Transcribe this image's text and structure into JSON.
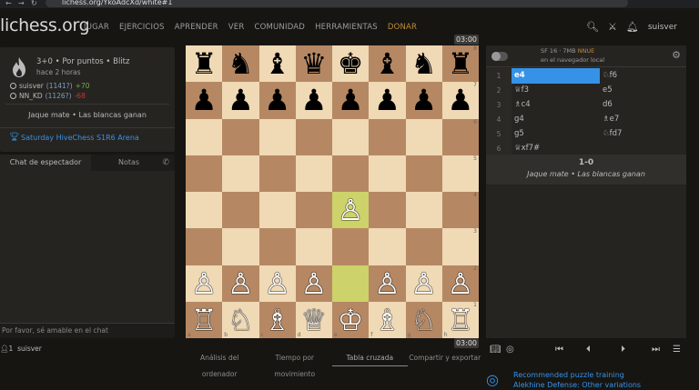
{
  "browser": {
    "url": "lichess.org/YkoAdcXd/white#1"
  },
  "header": {
    "logo": "lichess.org",
    "nav": [
      "JUGAR",
      "EJERCICIOS",
      "APRENDER",
      "VER",
      "COMUNIDAD",
      "HERRAMIENTAS",
      "DONAR"
    ],
    "username": "suisver"
  },
  "game": {
    "title": "3+0 • Por puntos • Blitz",
    "time_ago": "hace 2 horas",
    "white": {
      "name": "suisver",
      "rating": "(1141?)",
      "diff": "+70"
    },
    "black": {
      "name": "NN_KD",
      "rating": "(1126?)",
      "diff": "-68"
    },
    "result": "Jaque mate • Las blancas ganan",
    "tournament": "Saturday HiveChess S1R6 Arena"
  },
  "chat": {
    "tab_active": "Chat de espectador",
    "tab_notes": "Notas",
    "placeholder": "Por favor, sé amable en el chat",
    "spectators_count": "1",
    "spectator": "suisver"
  },
  "clocks": {
    "top": "03:00",
    "bottom": "03:00"
  },
  "board": {
    "ranks": [
      [
        "♜",
        "♞",
        "♝",
        "♛",
        "♚",
        "♝",
        "♞",
        "♜"
      ],
      [
        "♟",
        "♟",
        "♟",
        "♟",
        "♟",
        "♟",
        "♟",
        "♟"
      ],
      [
        "",
        "",
        "",
        "",
        "",
        "",
        "",
        ""
      ],
      [
        "",
        "",
        "",
        "",
        "",
        "",
        "",
        ""
      ],
      [
        "",
        "",
        "",
        "",
        "♙",
        "",
        "",
        ""
      ],
      [
        "",
        "",
        "",
        "",
        "",
        "",
        "",
        ""
      ],
      [
        "♙",
        "♙",
        "♙",
        "♙",
        "",
        "♙",
        "♙",
        "♙"
      ],
      [
        "♖",
        "♘",
        "♗",
        "♕",
        "♔",
        "♗",
        "♘",
        "♖"
      ]
    ],
    "rank_labels": [
      "8",
      "7",
      "6",
      "5",
      "4",
      "3",
      "2",
      "1"
    ],
    "file_labels": [
      "a",
      "b",
      "c",
      "d",
      "e",
      "f",
      "g",
      "h"
    ]
  },
  "board_tabs": [
    "Análisis del ordenador",
    "Tiempo por movimiento",
    "Tabla cruzada",
    "Compartir y exportar"
  ],
  "engine": {
    "name": "SF 16 · 7MB",
    "nnue": "NNUE",
    "location": "en el navegador local"
  },
  "moves": [
    {
      "n": "1",
      "w": "e4",
      "b": "♘f6"
    },
    {
      "n": "2",
      "w": "♕f3",
      "b": "e5"
    },
    {
      "n": "3",
      "w": "♗c4",
      "b": "d6"
    },
    {
      "n": "4",
      "w": "g4",
      "b": "♗e7"
    },
    {
      "n": "5",
      "w": "g5",
      "b": "♘fd7"
    },
    {
      "n": "6",
      "w": "♕xf7#",
      "b": ""
    }
  ],
  "result": {
    "score": "1-0",
    "text": "Jaque mate • Las blancas ganan"
  },
  "puzzle": {
    "line1": "Recommended puzzle training",
    "line2": "Alekhine Defense: Other variations"
  }
}
